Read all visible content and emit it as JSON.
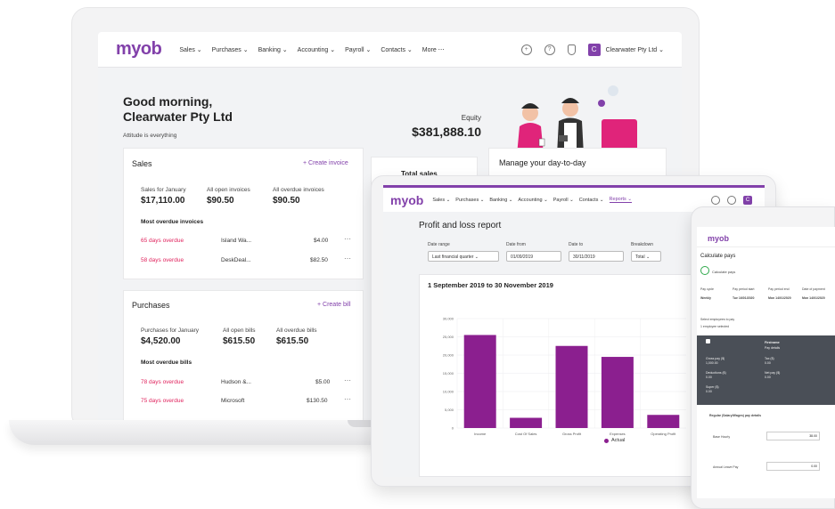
{
  "laptop": {
    "nav": {
      "logo": "myob",
      "items": [
        "Sales ⌄",
        "Purchases ⌄",
        "Banking ⌄",
        "Accounting ⌄",
        "Payroll ⌄",
        "Contacts ⌄",
        "More ⋯"
      ],
      "business_initial": "C",
      "business_name": "Clearwater Pty Ltd ⌄"
    },
    "greeting_line1": "Good morning,",
    "greeting_line2": "Clearwater Pty Ltd",
    "attitude": "Attitude is everything",
    "equity_label": "Equity",
    "equity_value": "$381,888.10",
    "sales": {
      "title": "Sales",
      "create_link": "+ Create invoice",
      "stat1_label": "Sales for January",
      "stat1_value": "$17,110.00",
      "stat2_label": "All open invoices",
      "stat2_value": "$90.50",
      "stat3_label": "All overdue invoices",
      "stat3_value": "$90.50",
      "section": "Most overdue invoices",
      "rows": [
        {
          "status": "65 days overdue",
          "name": "Island Wa...",
          "amount": "$4.00"
        },
        {
          "status": "58 days overdue",
          "name": "DeskDeal...",
          "amount": "$82.50"
        }
      ]
    },
    "purchases": {
      "title": "Purchases",
      "create_link": "+ Create bill",
      "stat1_label": "Purchases for January",
      "stat1_value": "$4,520.00",
      "stat2_label": "All open bills",
      "stat2_value": "$615.50",
      "stat3_label": "All overdue bills",
      "stat3_value": "$615.50",
      "section": "Most overdue bills",
      "rows": [
        {
          "status": "78 days overdue",
          "name": "Hudson &...",
          "amount": "$5.00"
        },
        {
          "status": "75 days overdue",
          "name": "Microsoft",
          "amount": "$130.50"
        }
      ]
    },
    "total_sales": "Total sales",
    "manage": "Manage your day-to-day"
  },
  "tablet": {
    "nav": {
      "logo": "myob",
      "items": [
        "Sales ⌄",
        "Purchases ⌄",
        "Banking ⌄",
        "Accounting ⌄",
        "Payroll ⌄",
        "Contacts ⌄",
        "Reports ⌄"
      ]
    },
    "report_title": "Profit and loss report",
    "filters": [
      {
        "label": "Date range",
        "value": "Last financial quarter ⌄"
      },
      {
        "label": "Date from",
        "value": "01/09/2019"
      },
      {
        "label": "Date to",
        "value": "30/11/2019"
      },
      {
        "label": "Breakdown",
        "value": "Total ⌄"
      }
    ],
    "period": "1 September 2019 to 30 November 2019"
  },
  "chart_data": {
    "type": "bar",
    "categories": [
      "Income",
      "Cost Of Sales",
      "Gross Profit",
      "Expenses",
      "Operating Profit"
    ],
    "series": [
      {
        "name": "Actual",
        "values": [
          25500,
          2800,
          22500,
          19500,
          3600
        ]
      }
    ],
    "ylim": [
      0,
      30000
    ],
    "yticks": [
      "30,000",
      "25,000",
      "20,000",
      "15,000",
      "10,000",
      "5,000",
      "0"
    ],
    "legend": "bottom",
    "color": "#8b1f8f"
  },
  "phone": {
    "logo": "myob",
    "title": "Calculate pays",
    "step": "Calculate pays",
    "cols": [
      "Pay cycle",
      "Pay period start",
      "Pay period end",
      "Date of payment"
    ],
    "vals": [
      "Weekly",
      "Tue 16/01/2020",
      "Mon 14/01/2020",
      "Mon 14/01/2020"
    ],
    "hint1": "Select employees to pay",
    "hint2": "1 employee selected",
    "dark_name": "Firstname",
    "dark_sub": "Pay details",
    "dark_items": [
      "Gross pay ($)",
      "1,000.00",
      "Tax ($)",
      "0.00",
      "Deductions ($)",
      "0.00",
      "Net pay ($)",
      "0.00",
      "Super ($)",
      "0.00"
    ],
    "section": "Regular (Salary/Wages) pay details",
    "fields": [
      {
        "label": "Base Hourly",
        "value": "38.00"
      },
      {
        "label": "Annual Leave Pay",
        "value": "0.00"
      }
    ]
  }
}
